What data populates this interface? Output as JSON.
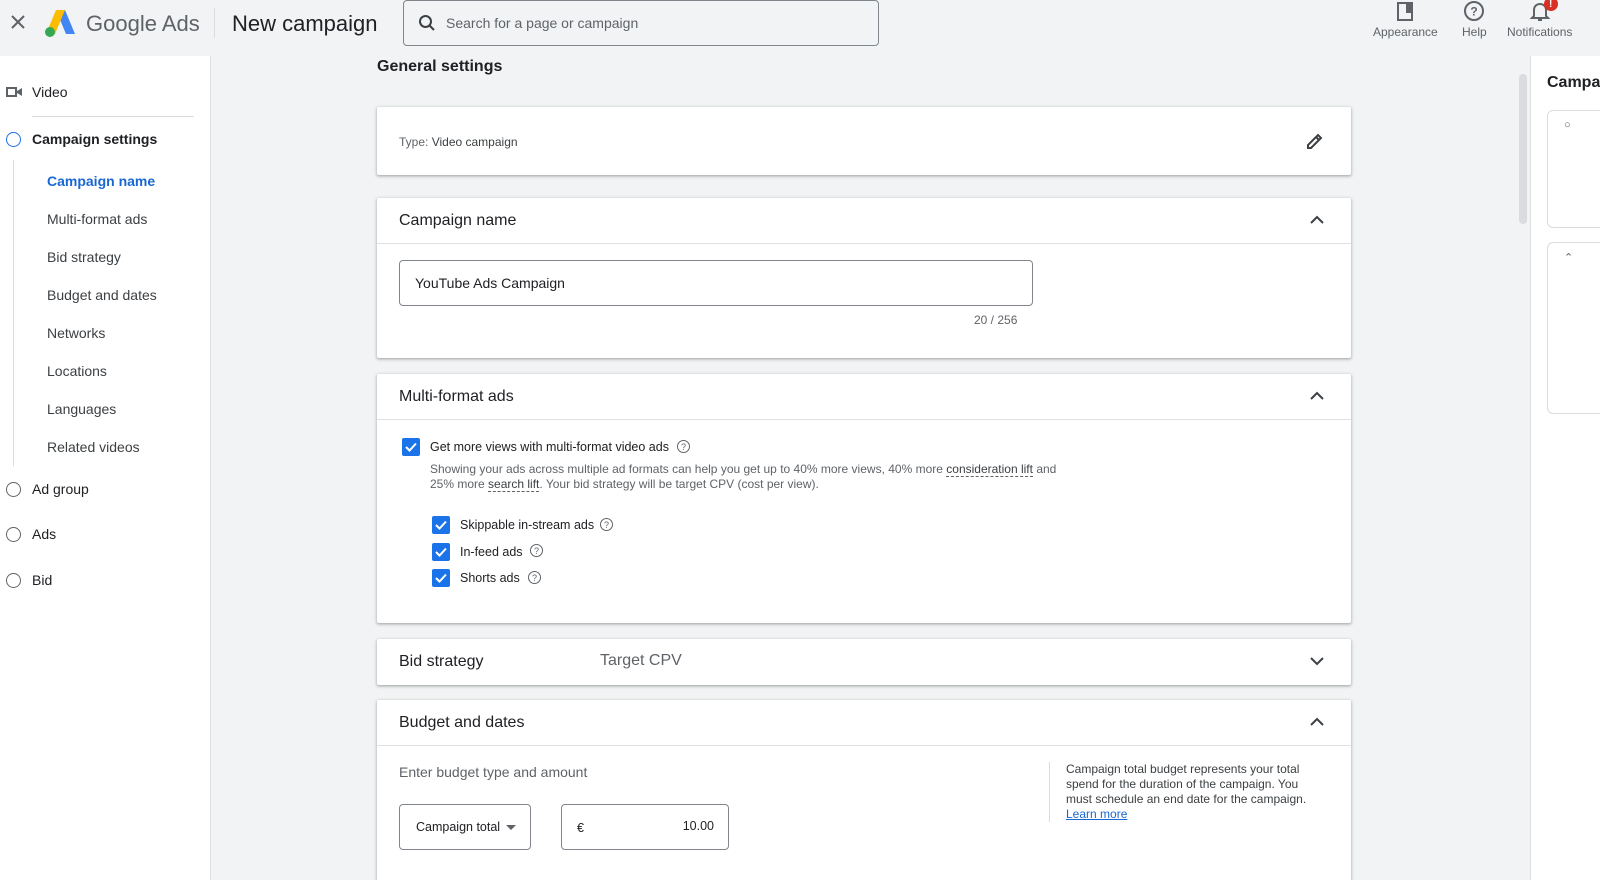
{
  "topbar": {
    "brand": "Google Ads",
    "page_title": "New campaign",
    "search_placeholder": "Search for a page or campaign",
    "actions": [
      {
        "label": "Appearance",
        "icon": "appearance-icon"
      },
      {
        "label": "Help",
        "icon": "help-icon"
      },
      {
        "label": "Notifications",
        "icon": "bell-icon",
        "badge": "!"
      }
    ]
  },
  "sidebar": {
    "video_label": "Video",
    "steps": [
      {
        "label": "Campaign settings",
        "active": true
      },
      {
        "label": "Ad group",
        "active": false
      },
      {
        "label": "Ads",
        "active": false
      },
      {
        "label": "Bid",
        "active": false
      }
    ],
    "sub_items": [
      "Campaign name",
      "Multi-format ads",
      "Bid strategy",
      "Budget and dates",
      "Networks",
      "Locations",
      "Languages",
      "Related videos"
    ]
  },
  "main": {
    "section_heading": "General settings",
    "type_card": {
      "key": "Type:",
      "value": "Video campaign"
    },
    "campaign_name": {
      "title": "Campaign name",
      "value": "YouTube Ads Campaign",
      "counter": "20 / 256"
    },
    "multi_format": {
      "title": "Multi-format ads",
      "main_checkbox": "Get more views with multi-format video ads",
      "desc_part1": "Showing your ads across multiple ad formats can help you get up to 40% more views, 40% more ",
      "desc_link1": "consideration lift",
      "desc_part2": " and 25% more ",
      "desc_link2": "search lift",
      "desc_part3": ". Your bid strategy will be target CPV (cost per view).",
      "options": [
        "Skippable in-stream ads",
        "In-feed ads",
        "Shorts ads"
      ]
    },
    "bid_strategy": {
      "title": "Bid strategy",
      "value": "Target CPV"
    },
    "budget": {
      "title": "Budget and dates",
      "prompt": "Enter budget type and amount",
      "type_value": "Campaign total",
      "currency": "€",
      "amount": "10.00",
      "help_text": "Campaign total budget represents your total spend for the duration of the campaign. You must schedule an end date for the campaign.",
      "learn_more": "Learn more"
    }
  },
  "right_panel": {
    "title": "Campaign summary"
  },
  "colors": {
    "accent": "#1a73e8",
    "link": "#1967d2",
    "badge": "#d93025"
  }
}
